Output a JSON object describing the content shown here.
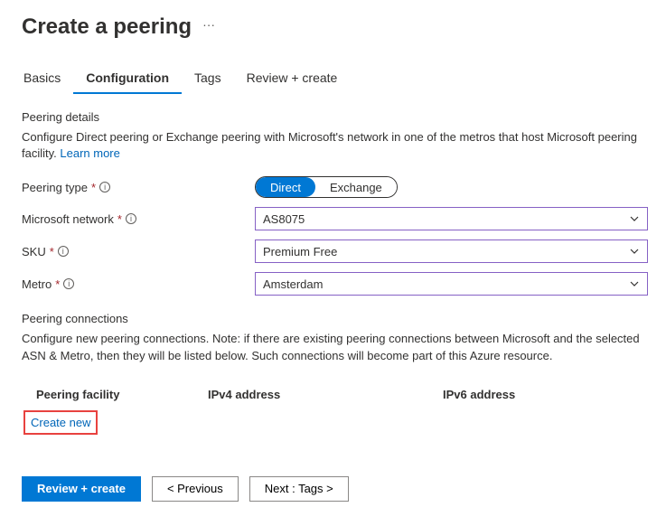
{
  "header": {
    "title": "Create a peering"
  },
  "tabs": {
    "items": [
      {
        "label": "Basics"
      },
      {
        "label": "Configuration"
      },
      {
        "label": "Tags"
      },
      {
        "label": "Review + create"
      }
    ],
    "activeIndex": 1
  },
  "peering_details": {
    "heading": "Peering details",
    "description_a": "Configure Direct peering or Exchange peering with Microsoft's network in one of the metros that host Microsoft peering facility. ",
    "learn_more": "Learn more"
  },
  "form": {
    "peering_type": {
      "label": "Peering type",
      "options": {
        "direct": "Direct",
        "exchange": "Exchange"
      },
      "selected": "direct"
    },
    "microsoft_network": {
      "label": "Microsoft network",
      "value": "AS8075"
    },
    "sku": {
      "label": "SKU",
      "value": "Premium Free"
    },
    "metro": {
      "label": "Metro",
      "value": "Amsterdam"
    }
  },
  "peering_connections": {
    "heading": "Peering connections",
    "description": "Configure new peering connections. Note: if there are existing peering connections between Microsoft and the selected ASN & Metro, then they will be listed below. Such connections will become part of this Azure resource.",
    "columns": {
      "facility": "Peering facility",
      "ipv4": "IPv4 address",
      "ipv6": "IPv6 address"
    },
    "create_new": "Create new"
  },
  "footer": {
    "review": "Review + create",
    "previous": "< Previous",
    "next": "Next : Tags >"
  }
}
